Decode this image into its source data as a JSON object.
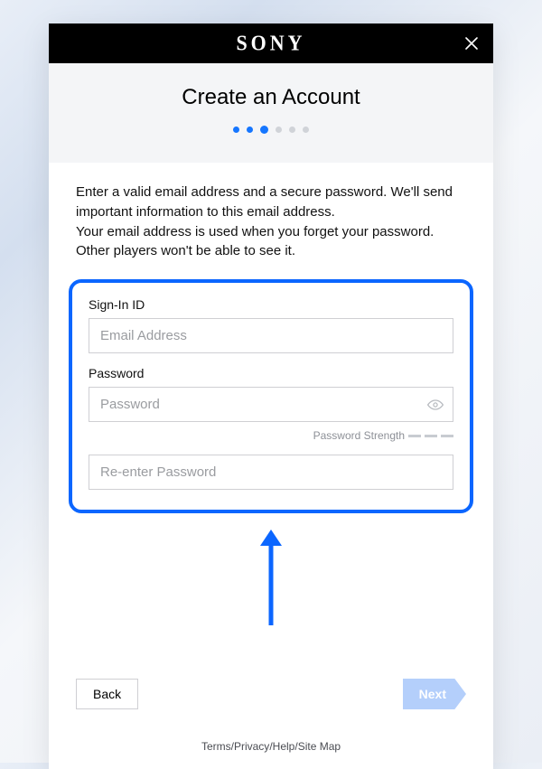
{
  "brand": "SONY",
  "title": "Create an Account",
  "stepper": {
    "total": 6,
    "filled": [
      0,
      1
    ],
    "active": 2
  },
  "instructions": {
    "line1": "Enter a valid email address and a secure password. We'll send important information to this email address.",
    "line2": "Your email address is used when you forget your password. Other players won't be able to see it."
  },
  "signin": {
    "label": "Sign-In ID",
    "placeholder": "Email Address",
    "value": ""
  },
  "password": {
    "label": "Password",
    "placeholder": "Password",
    "value": "",
    "strength_label": "Password Strength"
  },
  "confirm": {
    "placeholder": "Re-enter Password",
    "value": ""
  },
  "actions": {
    "back": "Back",
    "next": "Next"
  },
  "footer": {
    "links": [
      "Terms",
      "Privacy",
      "Help",
      "Site Map"
    ]
  }
}
